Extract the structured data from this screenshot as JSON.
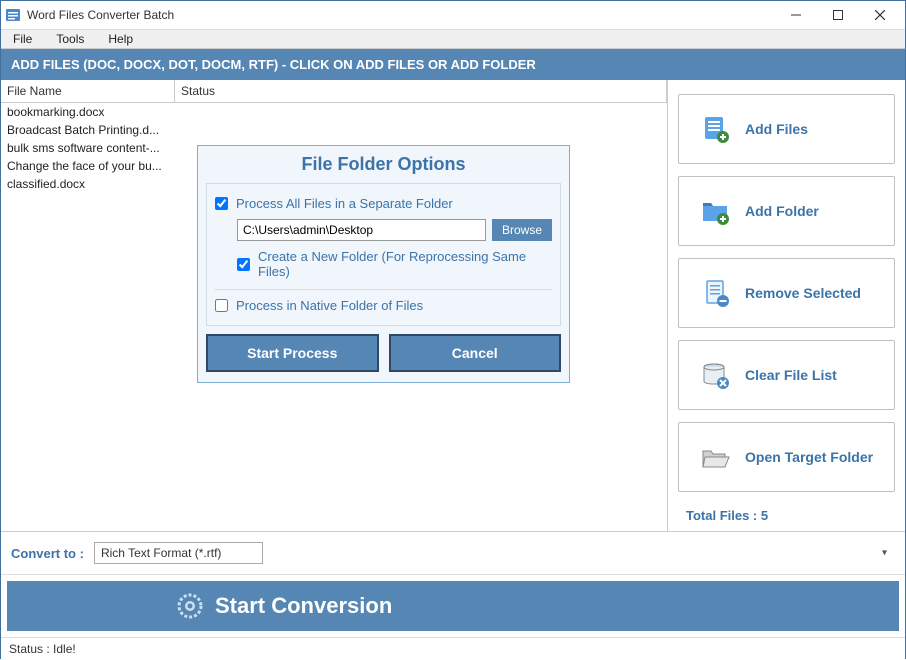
{
  "window": {
    "title": "Word Files Converter Batch"
  },
  "menus": [
    "File",
    "Tools",
    "Help"
  ],
  "header": "ADD FILES (DOC, DOCX, DOT, DOCM, RTF) - CLICK ON ADD FILES OR ADD FOLDER",
  "cols": {
    "file": "File Name",
    "status": "Status"
  },
  "files": [
    "bookmarking.docx",
    "Broadcast Batch Printing.d...",
    "bulk sms software content-...",
    "Change the face of your bu...",
    "classified.docx"
  ],
  "side": {
    "add_files": "Add Files",
    "add_folder": "Add Folder",
    "remove": "Remove Selected",
    "clear": "Clear File List",
    "open_target": "Open Target Folder",
    "total": "Total Files : 5"
  },
  "dialog": {
    "title": "File Folder Options",
    "process_all": "Process All Files in a Separate Folder",
    "path": "C:\\Users\\admin\\Desktop",
    "browse": "Browse",
    "create_new": "Create a New Folder (For Reprocessing Same Files)",
    "process_native": "Process in Native Folder of Files",
    "start": "Start Process",
    "cancel": "Cancel"
  },
  "convert": {
    "label": "Convert to :",
    "selected": "Rich Text Format (*.rtf)"
  },
  "start": "Start Conversion",
  "status": "Status  :  Idle!"
}
